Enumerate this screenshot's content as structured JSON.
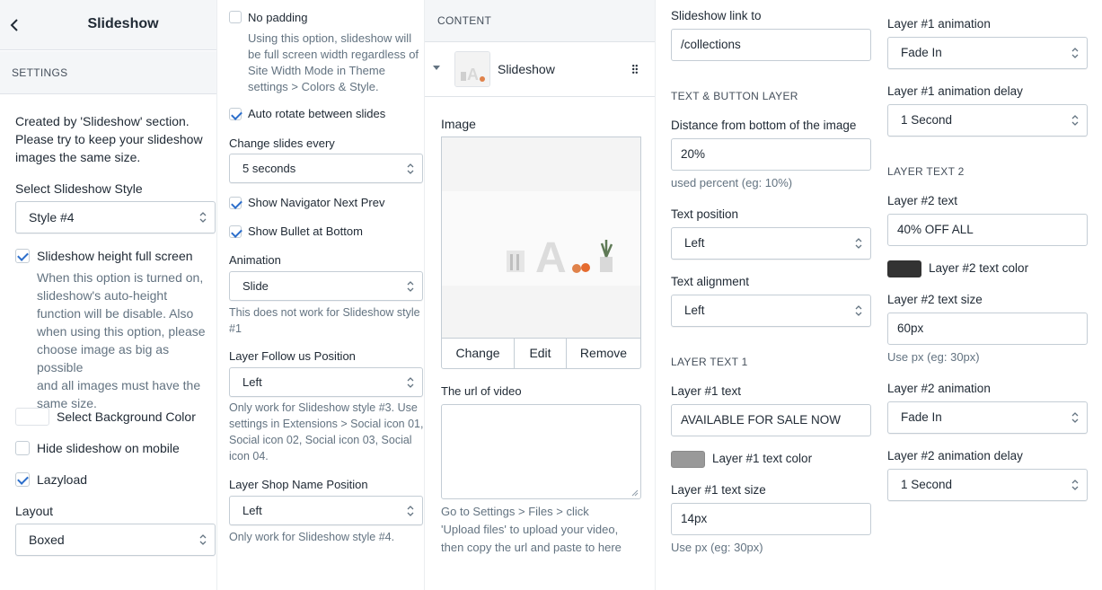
{
  "header": {
    "title": "Slideshow"
  },
  "settings_bar": {
    "label": "SETTINGS"
  },
  "col1": {
    "intro_lines": [
      "Created by 'Slideshow' section.",
      "Please try to keep your slideshow",
      "images the same size."
    ],
    "style_label": "Select Slideshow Style",
    "style_value": "Style #4",
    "height_label": "Slideshow height full screen",
    "height_help_lines": [
      "When this option is turned on,",
      "slideshow's auto-height",
      "function will be disable. Also",
      "when using this option, please",
      "choose image as big as possible",
      "and all images must have the",
      "same size."
    ],
    "bgcolor_label": "Select Background Color",
    "hide_mobile_label": "Hide slideshow on mobile",
    "lazyload_label": "Lazyload",
    "layout_label": "Layout",
    "layout_value": "Boxed"
  },
  "col2": {
    "nopadding_label": "No padding",
    "nopadding_help_lines": [
      "Using this option, slideshow will",
      "be full screen width regardless of",
      "Site Width Mode in Theme",
      "settings > Colors & Style."
    ],
    "autorotate_label": "Auto rotate between slides",
    "change_label": "Change slides every",
    "change_value": "5 seconds",
    "navigator_label": "Show Navigator Next Prev",
    "bullet_label": "Show Bullet at Bottom",
    "animation_label": "Animation",
    "animation_value": "Slide",
    "animation_help_lines": [
      "This does not work for Slideshow style",
      "#1"
    ],
    "follow_label": "Layer Follow us Position",
    "follow_value": "Left",
    "follow_help_lines": [
      "Only work for Slideshow style #3. Use",
      "settings in Extensions > Social icon 01,",
      "Social icon 02, Social icon 03, Social",
      "icon 04."
    ],
    "shopname_label": "Layer Shop Name Position",
    "shopname_value": "Left",
    "shopname_help": "Only work for Slideshow style #4."
  },
  "col3": {
    "content_label": "CONTENT",
    "block_name": "Slideshow",
    "image_label": "Image",
    "change_btn": "Change",
    "edit_btn": "Edit",
    "remove_btn": "Remove",
    "video_label": "The url of video",
    "video_help_lines": [
      "Go to Settings > Files > click",
      "'Upload files' to upload your video,",
      "then copy the url and paste to here"
    ]
  },
  "col4": {
    "link_label": "Slideshow link to",
    "link_value": "/collections",
    "textbtn_heading": "TEXT & BUTTON LAYER",
    "distance_label": "Distance from bottom of the image",
    "distance_value": "20%",
    "distance_help": "used percent (eg: 10%)",
    "textpos_label": "Text position",
    "textpos_value": "Left",
    "textalign_label": "Text alignment",
    "textalign_value": "Left",
    "layer1_heading": "LAYER TEXT 1",
    "l1_text_label": "Layer #1 text",
    "l1_text_value": "AVAILABLE FOR SALE NOW",
    "l1_color_label": "Layer #1 text color",
    "l1_color": "#999999",
    "l1_size_label": "Layer #1 text size",
    "l1_size_value": "14px",
    "l1_size_help": "Use px (eg: 30px)"
  },
  "col5": {
    "l1_anim_label": "Layer #1 animation",
    "l1_anim_value": "Fade In",
    "l1_delay_label": "Layer #1 animation delay",
    "l1_delay_value": "1 Second",
    "layer2_heading": "LAYER TEXT 2",
    "l2_text_label": "Layer #2 text",
    "l2_text_value": "40% OFF ALL",
    "l2_color_label": "Layer #2 text color",
    "l2_color": "#333333",
    "l2_size_label": "Layer #2 text size",
    "l2_size_value": "60px",
    "l2_size_help": "Use px (eg: 30px)",
    "l2_anim_label": "Layer #2 animation",
    "l2_anim_value": "Fade In",
    "l2_delay_label": "Layer #2 animation delay",
    "l2_delay_value": "1 Second"
  }
}
